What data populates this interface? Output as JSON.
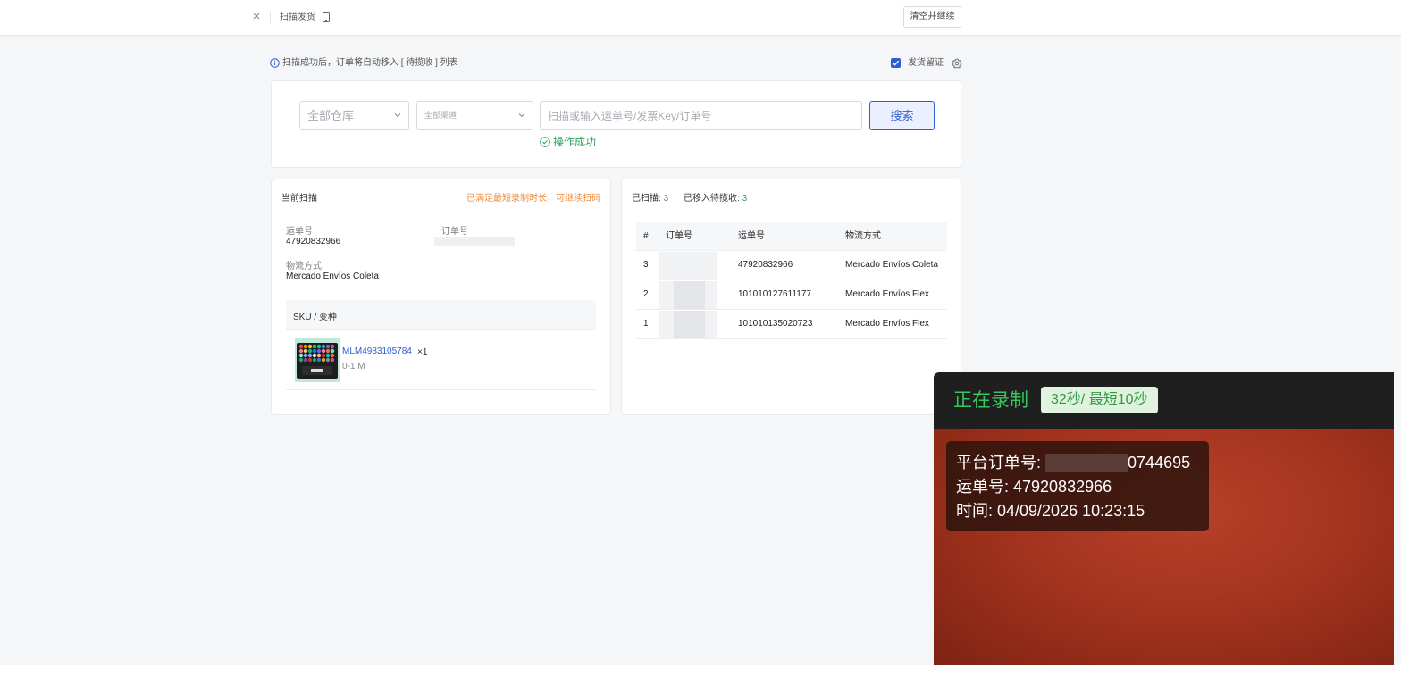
{
  "topbar": {
    "title": "扫描发货",
    "clear_button": "清空并继续"
  },
  "info": {
    "text": "扫描成功后，订单将自动移入 [ 待揽收 ] 列表",
    "proof_label": "发货留证",
    "proof_checked": true
  },
  "search": {
    "warehouse": "全部仓库",
    "channel": "全部渠道",
    "placeholder": "扫描或输入运单号/发票Key/订单号",
    "button": "搜索",
    "success": "操作成功"
  },
  "current": {
    "title": "当前扫描",
    "warning": "已满足最短录制时长，可继续扫码",
    "waybill_label": "运单号",
    "waybill": "47920832966",
    "order_label": "订单号",
    "logistics_label": "物流方式",
    "logistics": "Mercado Envíos Coleta",
    "sku_header": "SKU / 变种",
    "sku": {
      "id": "MLM4983105784",
      "qty": "×1",
      "variant": "0-1 M"
    }
  },
  "scanned": {
    "scanned_label": "已扫描:",
    "scanned_count": "3",
    "moved_label": "已移入待揽收:",
    "moved_count": "3",
    "columns": [
      "#",
      "订单号",
      "运单号",
      "物流方式"
    ],
    "rows": [
      {
        "idx": "3",
        "waybill": "47920832966",
        "logistics": "Mercado Envíos Coleta"
      },
      {
        "idx": "2",
        "waybill": "101010127611177",
        "logistics": "Mercado Envíos Flex"
      },
      {
        "idx": "1",
        "waybill": "101010135020723",
        "logistics": "Mercado Envíos Flex"
      }
    ]
  },
  "recording": {
    "title": "正在录制",
    "badge": "32秒/ 最短10秒",
    "order_label": "平台订单号:",
    "order_suffix": "0744695",
    "waybill_line": "运单号: 47920832966",
    "time_line": "时间: 04/09/2026 10:23:15"
  },
  "colors": {
    "primary": "#2f5bd3",
    "success": "#2fa35f",
    "warning": "#f08c3a",
    "recording_green": "#34c759"
  }
}
